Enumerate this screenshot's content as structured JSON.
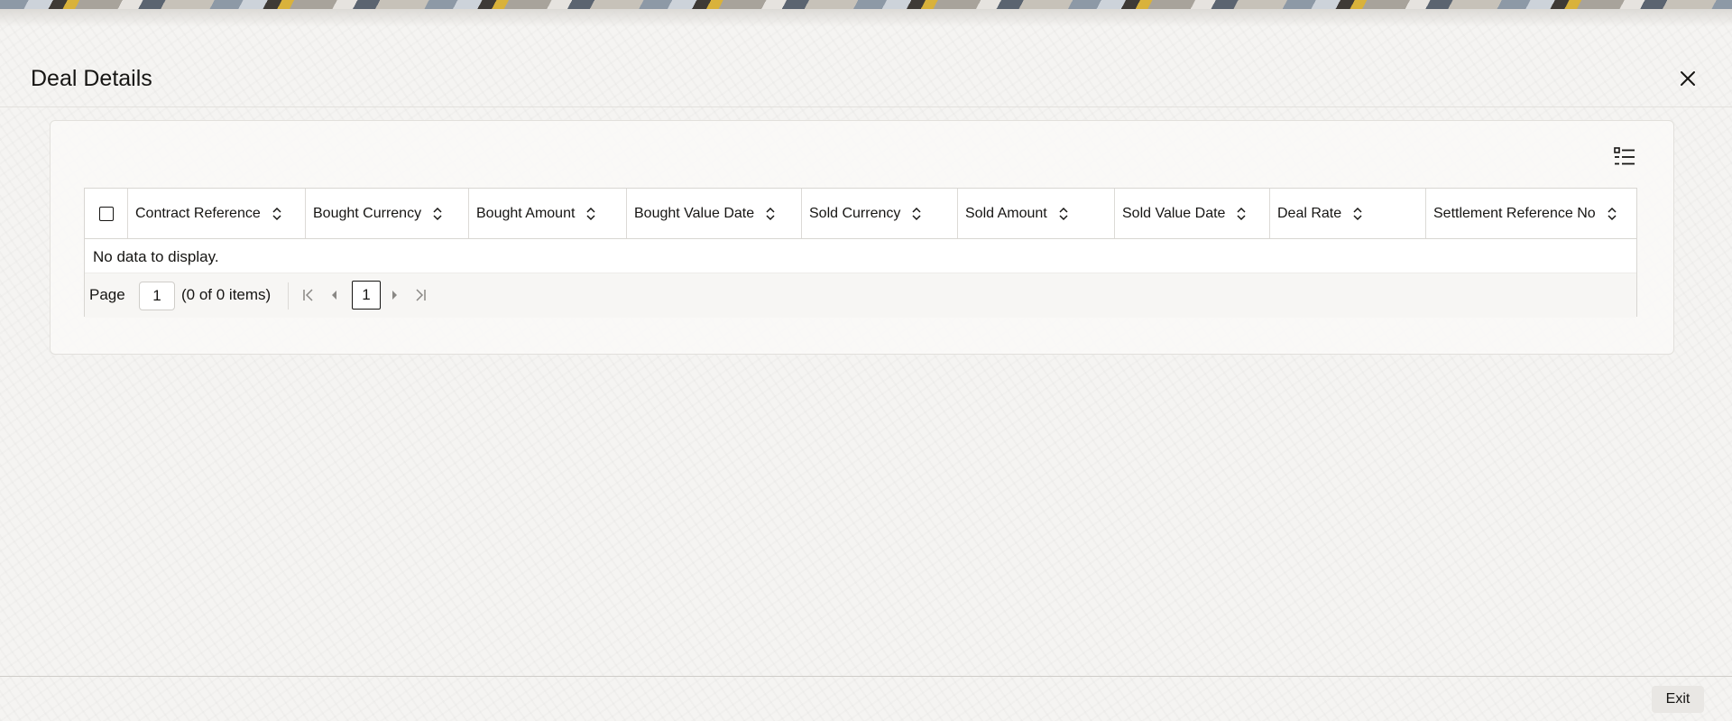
{
  "dialog": {
    "title": "Deal Details"
  },
  "grid": {
    "columns": [
      {
        "label": "Contract Reference"
      },
      {
        "label": "Bought Currency"
      },
      {
        "label": "Bought Amount"
      },
      {
        "label": "Bought Value Date"
      },
      {
        "label": "Sold Currency"
      },
      {
        "label": "Sold Amount"
      },
      {
        "label": "Sold Value Date"
      },
      {
        "label": "Deal Rate"
      },
      {
        "label": "Settlement Reference No"
      }
    ],
    "empty_message": "No data to display.",
    "rows": []
  },
  "pager": {
    "page_label": "Page",
    "page_input_value": "1",
    "item_count": "(0 of 0 items)",
    "current_page": "1"
  },
  "footer": {
    "exit_label": "Exit"
  },
  "icons": {
    "close": "close-icon",
    "columns": "column-list-icon",
    "sort": "sort-icon",
    "first": "first-page-icon",
    "prev": "previous-page-icon",
    "next": "next-page-icon",
    "last": "last-page-icon"
  }
}
